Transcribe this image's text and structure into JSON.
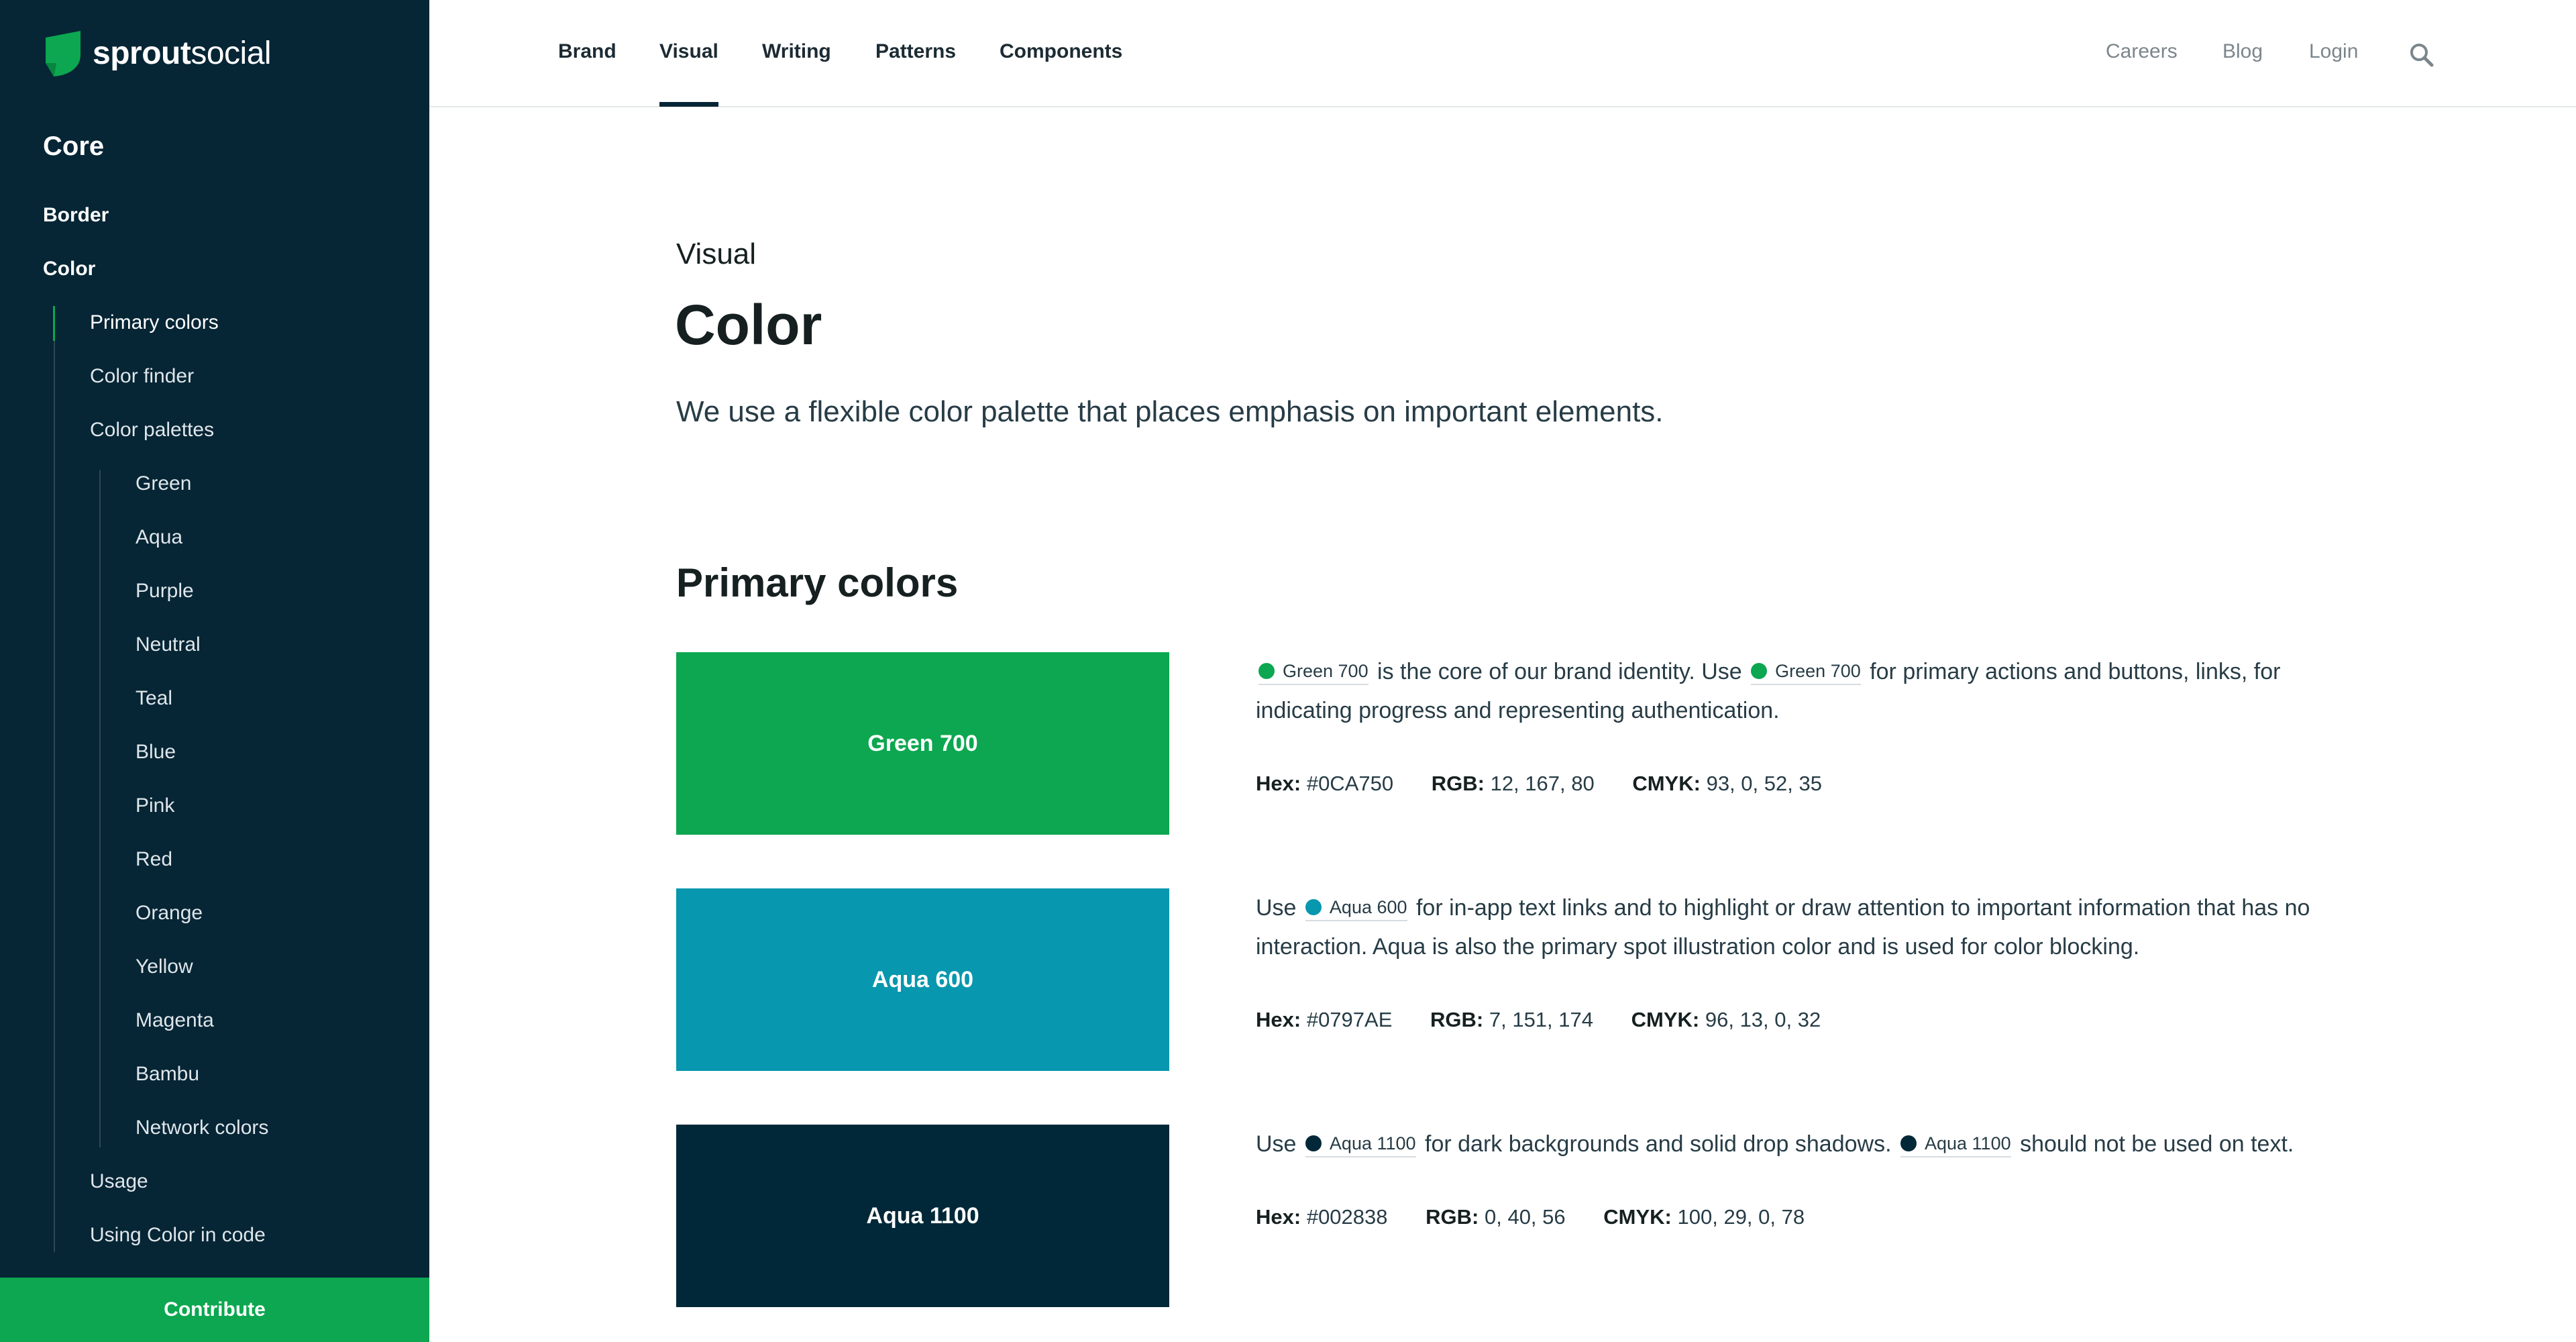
{
  "brand": {
    "logo_bold": "sprout",
    "logo_light": "social"
  },
  "sidebar": {
    "section": "Core",
    "items": [
      {
        "label": "Border"
      },
      {
        "label": "Color"
      },
      {
        "label": "Primary colors"
      },
      {
        "label": "Color finder"
      },
      {
        "label": "Color palettes"
      },
      {
        "label": "Green"
      },
      {
        "label": "Aqua"
      },
      {
        "label": "Purple"
      },
      {
        "label": "Neutral"
      },
      {
        "label": "Teal"
      },
      {
        "label": "Blue"
      },
      {
        "label": "Pink"
      },
      {
        "label": "Red"
      },
      {
        "label": "Orange"
      },
      {
        "label": "Yellow"
      },
      {
        "label": "Magenta"
      },
      {
        "label": "Bambu"
      },
      {
        "label": "Network colors"
      },
      {
        "label": "Usage"
      },
      {
        "label": "Using Color in code"
      }
    ],
    "contribute": "Contribute"
  },
  "nav": {
    "main": [
      "Brand",
      "Visual",
      "Writing",
      "Patterns",
      "Components"
    ],
    "active": "Visual",
    "right": [
      "Careers",
      "Blog",
      "Login"
    ],
    "search_icon": "search-icon"
  },
  "page": {
    "eyebrow": "Visual",
    "title": "Color",
    "intro": "We use a flexible color palette that places emphasis on important elements.",
    "section_title": "Primary colors"
  },
  "colors": {
    "green700": "#0CA750",
    "aqua600": "#0797AE",
    "aqua1100": "#002838",
    "sidebar_bg": "#062535"
  },
  "primary_colors": [
    {
      "name": "Green 700",
      "desc": {
        "t1": "is the core of our brand identity. Use",
        "t2": "for primary actions and buttons, links, for indicating progress and representing authentication."
      },
      "hex_label": "Hex:",
      "hex": "#0CA750",
      "rgb_label": "RGB:",
      "rgb": "12, 167, 80",
      "cmyk_label": "CMYK:",
      "cmyk": "93, 0, 52, 35"
    },
    {
      "name": "Aqua 600",
      "desc": {
        "t0": "Use",
        "t1": "for in-app text links and to highlight or draw attention to important information that has no interaction. Aqua is also the primary spot illustration color and is used for color blocking."
      },
      "hex_label": "Hex:",
      "hex": "#0797AE",
      "rgb_label": "RGB:",
      "rgb": "7, 151, 174",
      "cmyk_label": "CMYK:",
      "cmyk": "96, 13, 0, 32"
    },
    {
      "name": "Aqua 1100",
      "desc": {
        "t0": "Use",
        "t1": "for dark backgrounds and solid drop shadows.",
        "t2": "should not be used on text."
      },
      "hex_label": "Hex:",
      "hex": "#002838",
      "rgb_label": "RGB:",
      "rgb": "0, 40, 56",
      "cmyk_label": "CMYK:",
      "cmyk": "100, 29, 0, 78"
    }
  ]
}
